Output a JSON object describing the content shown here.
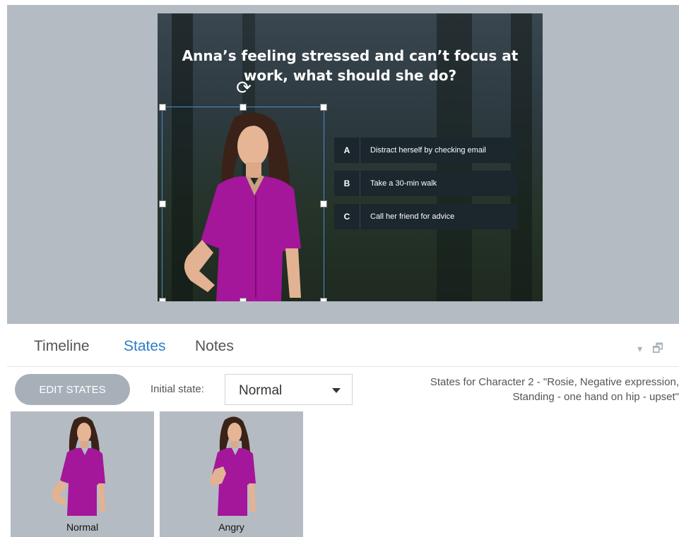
{
  "slide": {
    "question": "Anna’s feeling stressed and can’t focus at work, what should she do?",
    "answers": [
      {
        "letter": "A",
        "text": "Distract herself by checking email"
      },
      {
        "letter": "B",
        "text": "Take a 30-min walk"
      },
      {
        "letter": "C",
        "text": "Call her friend for advice"
      }
    ]
  },
  "panel": {
    "tabs": [
      "Timeline",
      "States",
      "Notes"
    ],
    "active_tab": "States",
    "edit_states_label": "EDIT STATES",
    "initial_state_label": "Initial state:",
    "initial_state_value": "Normal",
    "states_info_line1": "States for Character 2 - \"Rosie, Negative expression,",
    "states_info_line2": "Standing - one hand on hip - upset\"",
    "states": [
      {
        "label": "Normal"
      },
      {
        "label": "Angry"
      }
    ]
  },
  "colors": {
    "accent": "#2e7cc7",
    "shirt": "#a4169a",
    "selection": "#4a8ed0"
  }
}
